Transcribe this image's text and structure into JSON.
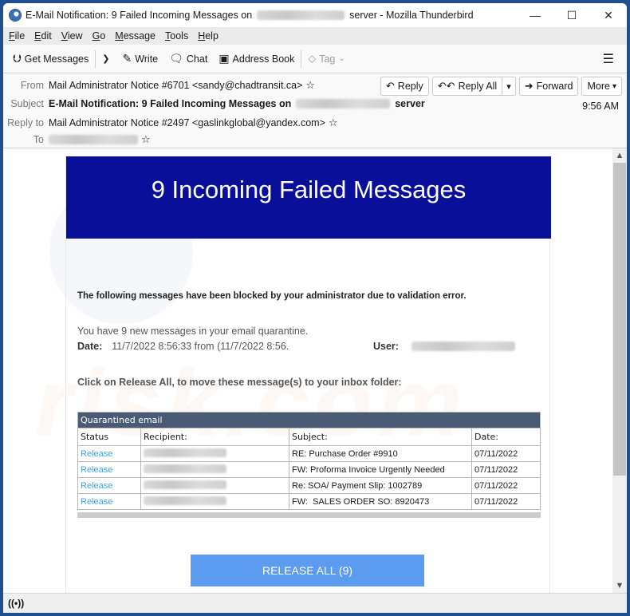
{
  "window": {
    "title_prefix": "E-Mail Notification: 9 Failed Incoming Messages on",
    "title_suffix": "server - Mozilla Thunderbird",
    "controls": {
      "minimize": "—",
      "maximize": "☐",
      "close": "✕"
    }
  },
  "menubar": {
    "items": [
      {
        "label": "File",
        "accel": "F",
        "rest": "ile"
      },
      {
        "label": "Edit",
        "accel": "E",
        "rest": "dit"
      },
      {
        "label": "View",
        "accel": "V",
        "rest": "iew"
      },
      {
        "label": "Go",
        "accel": "G",
        "rest": "o"
      },
      {
        "label": "Message",
        "accel": "M",
        "rest": "essage"
      },
      {
        "label": "Tools",
        "accel": "T",
        "rest": "ools"
      },
      {
        "label": "Help",
        "accel": "H",
        "rest": "elp"
      }
    ]
  },
  "toolbar": {
    "get_messages": "Get Messages",
    "write": "Write",
    "chat": "Chat",
    "address_book": "Address Book",
    "tag": "Tag"
  },
  "header": {
    "labels": {
      "from": "From",
      "subject": "Subject",
      "reply_to": "Reply to",
      "to": "To"
    },
    "from": "Mail Administrator Notice #6701 <sandy@chadtransit.ca>",
    "subject_prefix": "E-Mail Notification: 9 Failed Incoming Messages on",
    "subject_suffix": "server",
    "reply_to": "Mail Administrator Notice #2497 <gaslinkglobal@yandex.com>",
    "time": "9:56 AM",
    "buttons": {
      "reply": "Reply",
      "reply_all": "Reply All",
      "forward": "Forward",
      "more": "More"
    }
  },
  "email": {
    "banner_title": "9 Incoming Failed Messages",
    "intro": "The following messages have been blocked by your administrator due to validation error.",
    "count_line": "You have 9 new messages in your email  quarantine.",
    "date_label": "Date:",
    "date_value": "11/7/2022 8:56:33 from (11/7/2022 8:56.",
    "user_label": "User:",
    "cta": "Click on Release All, to move these message(s) to your inbox folder:",
    "table": {
      "caption": "Quarantined email",
      "headers": [
        "Status",
        "Recipient:",
        "Subject:",
        "Date:"
      ],
      "rows": [
        {
          "status": "Release",
          "subject": "RE: Purchase Order #9910",
          "date": "07/11/2022"
        },
        {
          "status": "Release",
          "subject": "FW: Proforma Invoice Urgently Needed",
          "date": "07/11/2022"
        },
        {
          "status": "Release",
          "subject": "Re: SOA/ Payment Slip: 1002789",
          "date": "07/11/2022"
        },
        {
          "status": "Release",
          "subject": "FW:  SALES ORDER SO: 8920473",
          "date": "07/11/2022"
        }
      ]
    },
    "release_all": "RELEASE ALL (9)",
    "colors": {
      "banner": "#0a0f99",
      "table_caption": "#485a74",
      "release_button": "#5b9cf0",
      "link": "#4a9fd6"
    }
  },
  "watermark": "risk.com"
}
